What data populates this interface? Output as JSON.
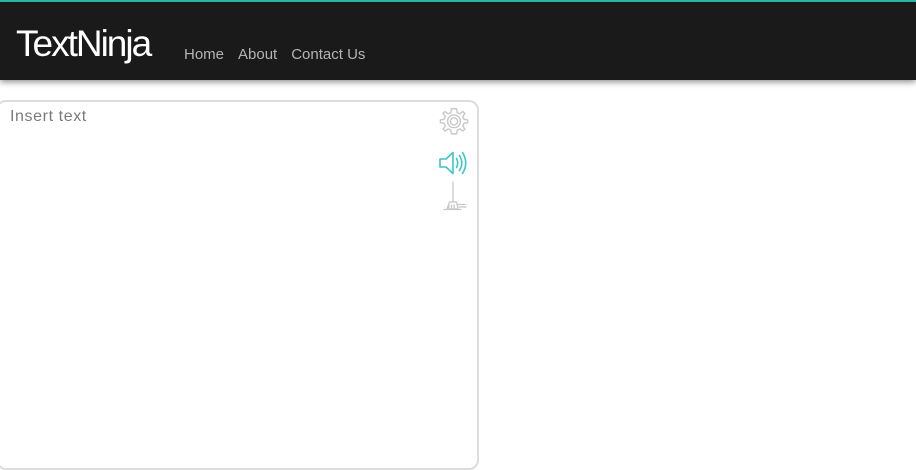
{
  "navbar": {
    "brand": "TextNinja",
    "links": [
      {
        "label": "Home"
      },
      {
        "label": "About"
      },
      {
        "label": "Contact Us"
      }
    ],
    "accent_color": "#2bb5a5",
    "background_color": "#1a1a1a"
  },
  "editor": {
    "placeholder": "Insert text",
    "value": "",
    "tools": [
      {
        "icon": "gear-icon",
        "color": "#c8c8c8"
      },
      {
        "icon": "speaker-icon",
        "color": "#3cc6c8"
      },
      {
        "icon": "broom-icon",
        "color": "#c8c8c8"
      }
    ]
  }
}
